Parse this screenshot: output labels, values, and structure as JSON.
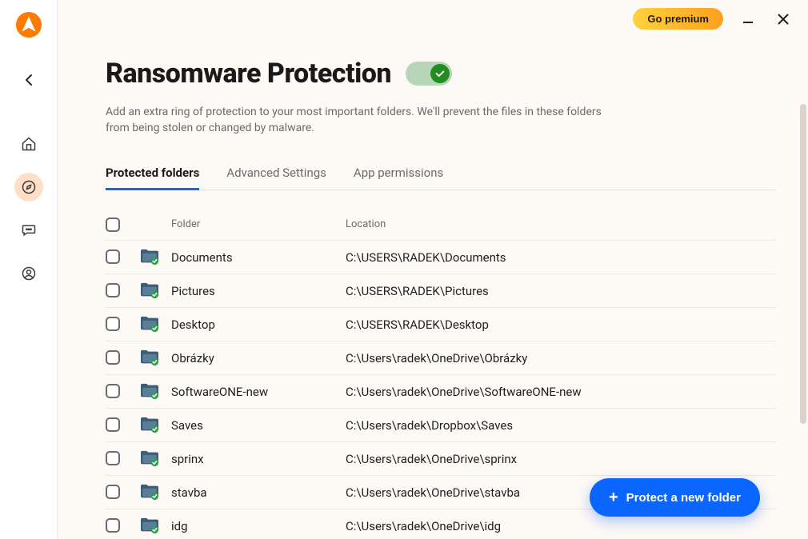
{
  "topbar": {
    "premium_label": "Go premium"
  },
  "header": {
    "title": "Ransomware Protection",
    "subtitle": "Add an extra ring of protection to your most important folders. We'll prevent the files in these folders from being stolen or changed by malware.",
    "enabled": true
  },
  "tabs": {
    "t0": "Protected folders",
    "t1": "Advanced Settings",
    "t2": "App permissions",
    "active_index": 0
  },
  "table": {
    "head_folder": "Folder",
    "head_location": "Location",
    "rows": [
      {
        "name": "Documents",
        "location": "C:\\USERS\\RADEK\\Documents"
      },
      {
        "name": "Pictures",
        "location": "C:\\USERS\\RADEK\\Pictures"
      },
      {
        "name": "Desktop",
        "location": "C:\\USERS\\RADEK\\Desktop"
      },
      {
        "name": "Obrázky",
        "location": "C:\\Users\\radek\\OneDrive\\Obrázky"
      },
      {
        "name": "SoftwareONE-new",
        "location": "C:\\Users\\radek\\OneDrive\\SoftwareONE-new"
      },
      {
        "name": "Saves",
        "location": "C:\\Users\\radek\\Dropbox\\Saves"
      },
      {
        "name": "sprinx",
        "location": "C:\\Users\\radek\\OneDrive\\sprinx"
      },
      {
        "name": "stavba",
        "location": "C:\\Users\\radek\\OneDrive\\stavba"
      },
      {
        "name": "idg",
        "location": "C:\\Users\\radek\\OneDrive\\idg"
      }
    ]
  },
  "fab": {
    "label": "Protect a new folder"
  },
  "colors": {
    "accent": "#0b66ff",
    "brand": "#ff7a00",
    "success": "#228b22"
  }
}
